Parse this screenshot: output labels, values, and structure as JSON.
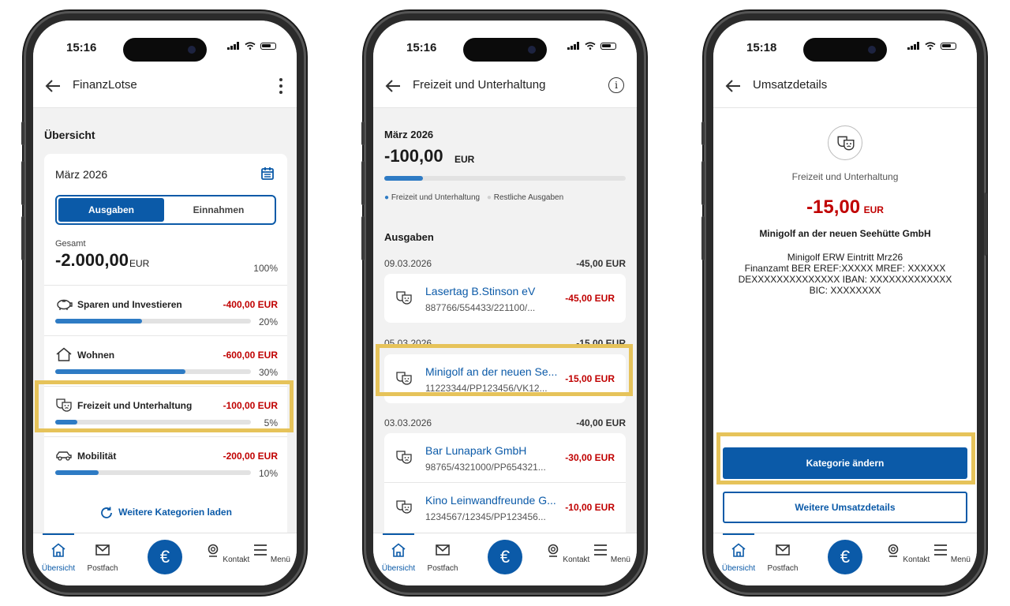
{
  "phones": [
    {
      "time": "15:16",
      "title": "FinanzLotse",
      "section_title": "Übersicht",
      "month": "März 2026",
      "toggle": {
        "active": "Ausgaben",
        "inactive": "Einnahmen"
      },
      "total_label": "Gesamt",
      "total_value": "-2.000,00",
      "total_currency": "EUR",
      "total_pct": "100%",
      "categories": [
        {
          "icon": "piggy-bank-icon",
          "name": "Sparen und Investieren",
          "amount": "-400,00 EUR",
          "pct": "20%",
          "fill": 0.2
        },
        {
          "icon": "house-icon",
          "name": "Wohnen",
          "amount": "-600,00 EUR",
          "pct": "30%",
          "fill": 0.3
        },
        {
          "icon": "theater-masks-icon",
          "name": "Freizeit und Unterhaltung",
          "amount": "-100,00 EUR",
          "pct": "5%",
          "fill": 0.05
        },
        {
          "icon": "car-icon",
          "name": "Mobilität",
          "amount": "-200,00 EUR",
          "pct": "10%",
          "fill": 0.1
        }
      ],
      "load_more": "Weitere Kategorien laden"
    },
    {
      "time": "15:16",
      "title": "Freizeit und Unterhaltung",
      "month": "März 2026",
      "total_value": "-100,00",
      "total_currency": "EUR",
      "progress": 0.16,
      "legend": [
        "Freizeit und Unterhaltung",
        "Restliche Ausgaben"
      ],
      "section_title": "Ausgaben",
      "groups": [
        {
          "date": "09.03.2026",
          "sum": "-45,00 EUR",
          "items": [
            {
              "name": "Lasertag B.Stinson eV",
              "ref": "887766/554433/221100/...",
              "amount": "-45,00 EUR"
            }
          ]
        },
        {
          "date": "05.03.2026",
          "sum": "-15,00 EUR",
          "items": [
            {
              "name": "Minigolf an der neuen Se...",
              "ref": "11223344/PP123456/VK12...",
              "amount": "-15,00 EUR"
            }
          ]
        },
        {
          "date": "03.03.2026",
          "sum": "-40,00 EUR",
          "items": [
            {
              "name": "Bar Lunapark GmbH",
              "ref": "98765/4321000/PP654321...",
              "amount": "-30,00 EUR"
            },
            {
              "name": "Kino Leinwandfreunde G...",
              "ref": "1234567/12345/PP123456...",
              "amount": "-10,00 EUR"
            }
          ]
        }
      ]
    },
    {
      "time": "15:18",
      "title": "Umsatzdetails",
      "category": "Freizeit und Unterhaltung",
      "amount": "-15,00",
      "currency": "EUR",
      "merchant": "Minigolf an der neuen Seehütte GmbH",
      "purpose": [
        "Minigolf ERW Eintritt Mrz26",
        "Finanzamt BER EREF:XXXXX MREF: XXXXXX",
        "DEXXXXXXXXXXXXXX IBAN: XXXXXXXXXXXXX",
        "BIC: XXXXXXXX"
      ],
      "primary_button": "Kategorie ändern",
      "secondary_button": "Weitere Umsatzdetails"
    }
  ],
  "nav": {
    "home": "Übersicht",
    "mail": "Postfach",
    "contact": "Kontakt",
    "menu": "Menü",
    "euro": "€"
  },
  "colors": {
    "accent": "#0b5aa8",
    "negative": "#c00000",
    "highlight": "#e6c35a"
  }
}
